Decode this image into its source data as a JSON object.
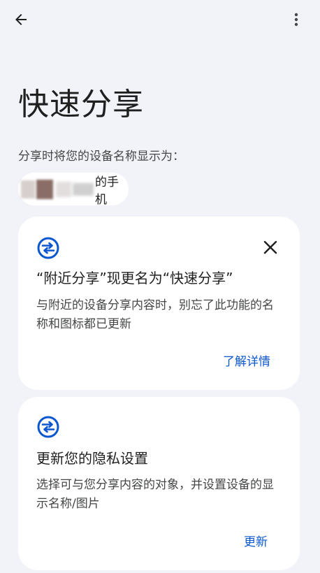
{
  "header": {
    "back_icon": "arrow-back-icon",
    "more_icon": "more-vert-icon"
  },
  "page": {
    "title": "快速分享",
    "subtitle": "分享时将您的设备名称显示为：",
    "device_name": "的手机"
  },
  "cards": [
    {
      "icon": "quick-share-icon",
      "title": "“附近分享”现更名为“快速分享”",
      "body": "与附近的设备分享内容时，别忘了此功能的名称和图标都已更新",
      "action": "了解详情",
      "close_icon": "close-icon"
    },
    {
      "icon": "quick-share-icon",
      "title": "更新您的隐私设置",
      "body": "选择可与您分享内容的对象，并设置设备的显示名称/图片",
      "action": "更新"
    }
  ],
  "colors": {
    "background": "#f1f3f8",
    "card": "#ffffff",
    "accent": "#0b57d0",
    "text_primary": "#1f1f1f",
    "text_secondary": "#444746"
  }
}
